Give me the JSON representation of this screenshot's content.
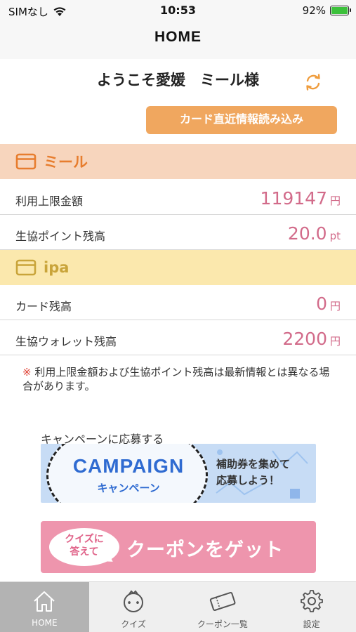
{
  "status_bar": {
    "carrier": "SIMなし",
    "time": "10:53",
    "battery": "92%"
  },
  "nav": {
    "title": "HOME"
  },
  "welcome": {
    "text": "ようこそ愛媛　ミール様",
    "refresh_icon": "refresh-icon",
    "card_button": "カード直近情報読み込み"
  },
  "sections": [
    {
      "title": "ミール",
      "color": "#e77d2e",
      "rows": [
        {
          "label": "利用上限金額",
          "value": "119147",
          "unit": "円"
        },
        {
          "label": "生協ポイント残高",
          "value": "20.0",
          "unit": "pt"
        }
      ]
    },
    {
      "title": "ipa",
      "color": "#c9a43a",
      "rows": [
        {
          "label": "カード残高",
          "value": "0",
          "unit": "円"
        },
        {
          "label": "生協ウォレット残高",
          "value": "2200",
          "unit": "円"
        }
      ]
    }
  ],
  "note": {
    "mark": "※",
    "text": "利用上限金額および生協ポイント残高は最新情報とは異なる場合があります。"
  },
  "campaign": {
    "caption": "キャンペーンに応募する",
    "title": "CAMPAIGN",
    "subtitle": "キャンペーン",
    "message_line1": "補助券を集めて",
    "message_line2": "応募しよう！"
  },
  "coupon": {
    "bubble_line1": "クイズに",
    "bubble_line2": "答えて",
    "text": "クーポンをゲット"
  },
  "tabs": [
    {
      "label": "HOME",
      "icon": "home-icon",
      "active": true
    },
    {
      "label": "クイズ",
      "icon": "quiz-icon",
      "active": false
    },
    {
      "label": "クーポン一覧",
      "icon": "coupon-icon",
      "active": false
    },
    {
      "label": "設定",
      "icon": "gear-icon",
      "active": false
    }
  ],
  "colors": {
    "accent_orange": "#f0a75f",
    "value_pink": "#d26b8a",
    "mil_header_bg": "#f7d5bd",
    "ipa_header_bg": "#fbe8ad"
  }
}
